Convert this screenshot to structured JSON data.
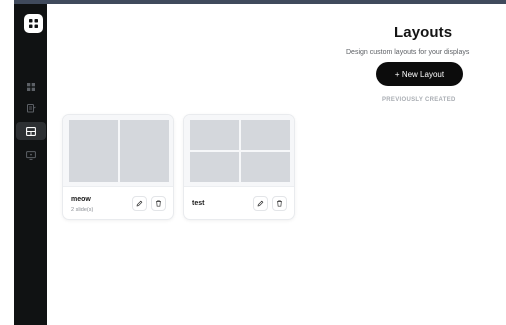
{
  "sidebar": {
    "logo_icon": "app-logo-icon",
    "items": [
      {
        "icon": "grid-icon",
        "active": false
      },
      {
        "icon": "slides-icon",
        "active": false
      },
      {
        "icon": "layouts-icon",
        "active": true
      },
      {
        "icon": "display-icon",
        "active": false
      }
    ]
  },
  "header": {
    "title": "Layouts",
    "subtitle": "Design custom layouts for your displays",
    "new_button_label": "+ New Layout",
    "section_label": "PREVIOUSLY CREATED"
  },
  "layouts": [
    {
      "name": "meow",
      "meta": "2 slide(s)",
      "preview": "two-columns",
      "tiles": 2
    },
    {
      "name": "test",
      "meta": "",
      "preview": "grid-2x2",
      "tiles": 4
    }
  ],
  "actions": {
    "edit_icon": "pencil-icon",
    "delete_icon": "trash-icon"
  },
  "colors": {
    "sidebar": "#101213",
    "accent": "#0c0c0c",
    "tile": "#d4d7dc",
    "topbar": "#404a5c"
  }
}
